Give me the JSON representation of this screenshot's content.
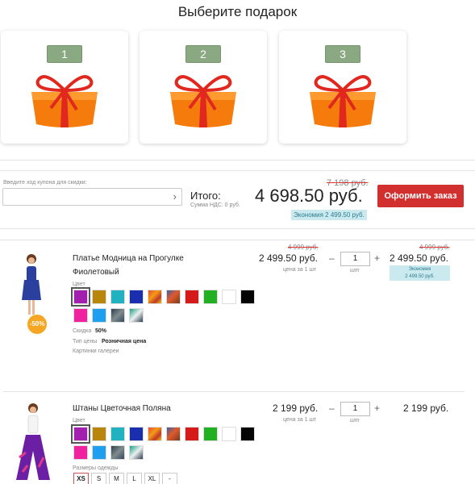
{
  "gifts": {
    "title": "Выберите подарок",
    "items": [
      "1",
      "2",
      "3"
    ]
  },
  "cart": {
    "coupon_label": "Введите ход купона для скидки:",
    "coupon_value": "",
    "total_label": "Итого:",
    "vat_label": "Сумма НДС: 0 руб.",
    "old_total": "7 198 руб.",
    "total": "4 698.50 руб.",
    "savings": "Экономия 2 499.50 руб.",
    "order_button": "Оформить заказ"
  },
  "products": [
    {
      "name_line1": "Платье Модница на Прогулке",
      "name_line2": "Фиолетовый",
      "old_price": "4 999 руб.",
      "price": "2 499.50 руб.",
      "unit_label": "цена за 1 шт",
      "qty": "1",
      "qty_unit": "шт",
      "sum_old": "4 999 руб.",
      "sum": "2 499.50 руб.",
      "sum_badge_line1": "Экономия",
      "sum_badge_line2": "2 499.50 руб.",
      "discount": "-50%",
      "color_label": "Цвет",
      "discount_label": "Скидка",
      "discount_value": "50%",
      "price_type_label": "Тип цены",
      "price_type_value": "Розничная цена",
      "gallery_label": "Картинки галереи"
    },
    {
      "name_line1": "Штаны Цветочная Поляна",
      "price": "2 199 руб.",
      "unit_label": "цена за 1 шт",
      "qty": "1",
      "qty_unit": "шт",
      "sum": "2 199 руб.",
      "color_label": "Цвет",
      "sizes_label": "Размеры одежды",
      "sizes": [
        "XS",
        "S",
        "M",
        "L",
        "XL",
        "-"
      ]
    }
  ],
  "qty_minus": "–",
  "qty_plus": "+",
  "colors": {
    "accent_red": "#d22f2f",
    "gift_label_green": "#8aa882",
    "savings_bg": "#cbeaf0",
    "badge_orange": "#f5a623"
  },
  "swatch_colors": [
    "#a21fb0",
    "#b8860b",
    "#20b2c0",
    "#1a2fb0",
    "pattern-red-orange",
    "pattern-red-blue",
    "#d61a1a",
    "#21b021",
    "#ffffff",
    "#050505",
    "#f0239f",
    "#1f9ff0",
    "pattern-dark",
    "pattern-teal"
  ]
}
